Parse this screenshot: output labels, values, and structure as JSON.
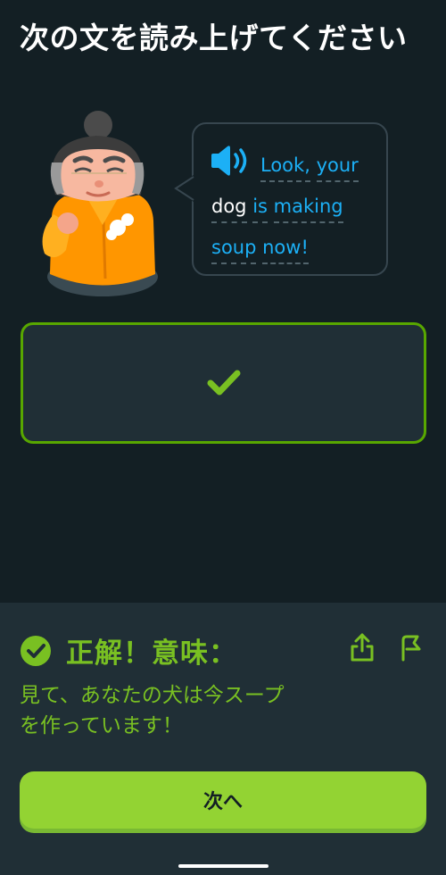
{
  "header": {
    "title": "次の文を読み上げてください"
  },
  "prompt": {
    "speaker_icon": "speaker-icon",
    "lines": [
      [
        "Look,",
        "your"
      ],
      [
        "dog",
        "is",
        "making"
      ],
      [
        "soup",
        "now!"
      ]
    ]
  },
  "answer": {
    "status_icon": "check-icon"
  },
  "feedback": {
    "title": "正解！意味：",
    "meaning_line1": "見て、あなたの犬は今スープ",
    "meaning_line2": "を作っています！",
    "icons": [
      "check-circle-icon",
      "share-icon",
      "flag-icon"
    ]
  },
  "footer": {
    "next_label": "次へ"
  },
  "colors": {
    "accent_blue": "#1cb0f6",
    "success_green": "#79c022",
    "button_green": "#93d333",
    "background": "#131f24"
  }
}
